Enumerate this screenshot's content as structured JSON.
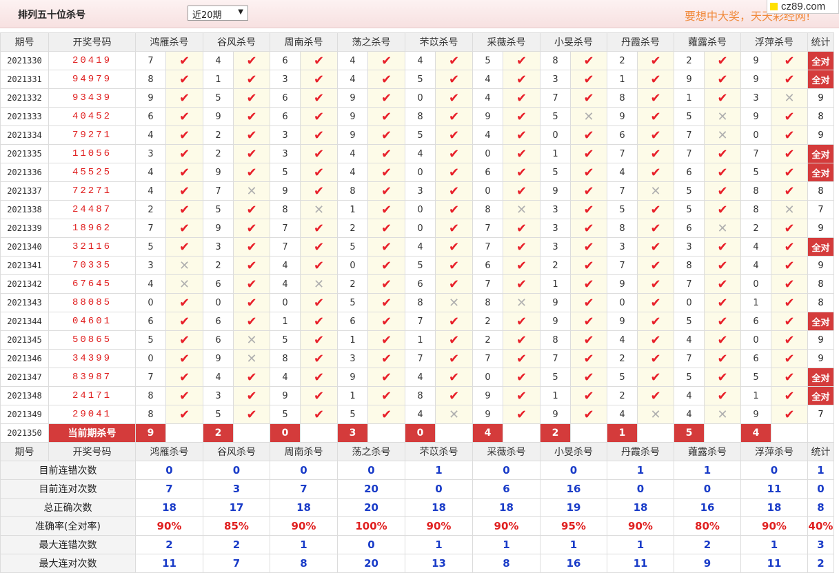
{
  "header": {
    "title": "排列五十位杀号",
    "range_selected": "近20期",
    "slogan": "要想中大奖，天天彩经网!",
    "logo_text": "cz89.com"
  },
  "table": {
    "headers": [
      "期号",
      "开奖号码",
      "鸿雁杀号",
      "谷风杀号",
      "周南杀号",
      "荡之杀号",
      "芣苡杀号",
      "采薇杀号",
      "小旻杀号",
      "丹霞杀号",
      "蕹露杀号",
      "浮萍杀号",
      "统计"
    ],
    "rows": [
      {
        "period": "2021330",
        "draw": "20419",
        "kills": [
          "7",
          "4",
          "6",
          "4",
          "4",
          "5",
          "8",
          "2",
          "2",
          "9"
        ],
        "hits": [
          1,
          1,
          1,
          1,
          1,
          1,
          1,
          1,
          1,
          1
        ],
        "total": "全对"
      },
      {
        "period": "2021331",
        "draw": "94979",
        "kills": [
          "8",
          "1",
          "3",
          "4",
          "5",
          "4",
          "3",
          "1",
          "9",
          "9"
        ],
        "hits": [
          1,
          1,
          1,
          1,
          1,
          1,
          1,
          1,
          1,
          1
        ],
        "total": "全对"
      },
      {
        "period": "2021332",
        "draw": "93439",
        "kills": [
          "9",
          "5",
          "6",
          "9",
          "0",
          "4",
          "7",
          "8",
          "1",
          "3"
        ],
        "hits": [
          1,
          1,
          1,
          1,
          1,
          1,
          1,
          1,
          1,
          0
        ],
        "total": "9"
      },
      {
        "period": "2021333",
        "draw": "40452",
        "kills": [
          "6",
          "9",
          "6",
          "9",
          "8",
          "9",
          "5",
          "9",
          "5",
          "9"
        ],
        "hits": [
          1,
          1,
          1,
          1,
          1,
          1,
          0,
          1,
          0,
          1
        ],
        "total": "8"
      },
      {
        "period": "2021334",
        "draw": "79271",
        "kills": [
          "4",
          "2",
          "3",
          "9",
          "5",
          "4",
          "0",
          "6",
          "7",
          "0"
        ],
        "hits": [
          1,
          1,
          1,
          1,
          1,
          1,
          1,
          1,
          0,
          1
        ],
        "total": "9"
      },
      {
        "period": "2021335",
        "draw": "11056",
        "kills": [
          "3",
          "2",
          "3",
          "4",
          "4",
          "0",
          "1",
          "7",
          "7",
          "7"
        ],
        "hits": [
          1,
          1,
          1,
          1,
          1,
          1,
          1,
          1,
          1,
          1
        ],
        "total": "全对"
      },
      {
        "period": "2021336",
        "draw": "45525",
        "kills": [
          "4",
          "9",
          "5",
          "4",
          "0",
          "6",
          "5",
          "4",
          "6",
          "5"
        ],
        "hits": [
          1,
          1,
          1,
          1,
          1,
          1,
          1,
          1,
          1,
          1
        ],
        "total": "全对"
      },
      {
        "period": "2021337",
        "draw": "72271",
        "kills": [
          "4",
          "7",
          "9",
          "8",
          "3",
          "0",
          "9",
          "7",
          "5",
          "8"
        ],
        "hits": [
          1,
          0,
          1,
          1,
          1,
          1,
          1,
          0,
          1,
          1
        ],
        "total": "8"
      },
      {
        "period": "2021338",
        "draw": "24487",
        "kills": [
          "2",
          "5",
          "8",
          "1",
          "0",
          "8",
          "3",
          "5",
          "5",
          "8"
        ],
        "hits": [
          1,
          1,
          0,
          1,
          1,
          0,
          1,
          1,
          1,
          0
        ],
        "total": "7"
      },
      {
        "period": "2021339",
        "draw": "18962",
        "kills": [
          "7",
          "9",
          "7",
          "2",
          "0",
          "7",
          "3",
          "8",
          "6",
          "2"
        ],
        "hits": [
          1,
          1,
          1,
          1,
          1,
          1,
          1,
          1,
          0,
          1
        ],
        "total": "9"
      },
      {
        "period": "2021340",
        "draw": "32116",
        "kills": [
          "5",
          "3",
          "7",
          "5",
          "4",
          "7",
          "3",
          "3",
          "3",
          "4"
        ],
        "hits": [
          1,
          1,
          1,
          1,
          1,
          1,
          1,
          1,
          1,
          1
        ],
        "total": "全对"
      },
      {
        "period": "2021341",
        "draw": "70335",
        "kills": [
          "3",
          "2",
          "4",
          "0",
          "5",
          "6",
          "2",
          "7",
          "8",
          "4"
        ],
        "hits": [
          0,
          1,
          1,
          1,
          1,
          1,
          1,
          1,
          1,
          1
        ],
        "total": "9"
      },
      {
        "period": "2021342",
        "draw": "67645",
        "kills": [
          "4",
          "6",
          "4",
          "2",
          "6",
          "7",
          "1",
          "9",
          "7",
          "0"
        ],
        "hits": [
          0,
          1,
          0,
          1,
          1,
          1,
          1,
          1,
          1,
          1
        ],
        "total": "8"
      },
      {
        "period": "2021343",
        "draw": "88085",
        "kills": [
          "0",
          "0",
          "0",
          "5",
          "8",
          "8",
          "9",
          "0",
          "0",
          "1"
        ],
        "hits": [
          1,
          1,
          1,
          1,
          0,
          0,
          1,
          1,
          1,
          1
        ],
        "total": "8"
      },
      {
        "period": "2021344",
        "draw": "04601",
        "kills": [
          "6",
          "6",
          "1",
          "6",
          "7",
          "2",
          "9",
          "9",
          "5",
          "6"
        ],
        "hits": [
          1,
          1,
          1,
          1,
          1,
          1,
          1,
          1,
          1,
          1
        ],
        "total": "全对"
      },
      {
        "period": "2021345",
        "draw": "50865",
        "kills": [
          "5",
          "6",
          "5",
          "1",
          "1",
          "2",
          "8",
          "4",
          "4",
          "0"
        ],
        "hits": [
          1,
          0,
          1,
          1,
          1,
          1,
          1,
          1,
          1,
          1
        ],
        "total": "9"
      },
      {
        "period": "2021346",
        "draw": "34399",
        "kills": [
          "0",
          "9",
          "8",
          "3",
          "7",
          "7",
          "7",
          "2",
          "7",
          "6"
        ],
        "hits": [
          1,
          0,
          1,
          1,
          1,
          1,
          1,
          1,
          1,
          1
        ],
        "total": "9"
      },
      {
        "period": "2021347",
        "draw": "83987",
        "kills": [
          "7",
          "4",
          "4",
          "9",
          "4",
          "0",
          "5",
          "5",
          "5",
          "5"
        ],
        "hits": [
          1,
          1,
          1,
          1,
          1,
          1,
          1,
          1,
          1,
          1
        ],
        "total": "全对"
      },
      {
        "period": "2021348",
        "draw": "24171",
        "kills": [
          "8",
          "3",
          "9",
          "1",
          "8",
          "9",
          "1",
          "2",
          "4",
          "1"
        ],
        "hits": [
          1,
          1,
          1,
          1,
          1,
          1,
          1,
          1,
          1,
          1
        ],
        "total": "全对"
      },
      {
        "period": "2021349",
        "draw": "29041",
        "kills": [
          "8",
          "5",
          "5",
          "5",
          "4",
          "9",
          "9",
          "4",
          "4",
          "9"
        ],
        "hits": [
          1,
          1,
          1,
          1,
          0,
          1,
          1,
          0,
          0,
          1
        ],
        "total": "7"
      }
    ],
    "current": {
      "period": "2021350",
      "label": "当前期杀号",
      "kills": [
        "9",
        "2",
        "0",
        "3",
        "0",
        "4",
        "2",
        "1",
        "5",
        "4"
      ]
    },
    "stats": [
      {
        "label": "目前连错次数",
        "values": [
          "0",
          "0",
          "0",
          "0",
          "1",
          "0",
          "0",
          "1",
          "1",
          "0",
          "1"
        ],
        "pct": false
      },
      {
        "label": "目前连对次数",
        "values": [
          "7",
          "3",
          "7",
          "20",
          "0",
          "6",
          "16",
          "0",
          "0",
          "11",
          "0"
        ],
        "pct": false
      },
      {
        "label": "总正确次数",
        "values": [
          "18",
          "17",
          "18",
          "20",
          "18",
          "18",
          "19",
          "18",
          "16",
          "18",
          "8"
        ],
        "pct": false
      },
      {
        "label": "准确率(全对率)",
        "values": [
          "90%",
          "85%",
          "90%",
          "100%",
          "90%",
          "90%",
          "95%",
          "90%",
          "80%",
          "90%",
          "40%"
        ],
        "pct": true
      },
      {
        "label": "最大连错次数",
        "values": [
          "2",
          "2",
          "1",
          "0",
          "1",
          "1",
          "1",
          "1",
          "2",
          "1",
          "3"
        ],
        "pct": false
      },
      {
        "label": "最大连对次数",
        "values": [
          "11",
          "7",
          "8",
          "20",
          "13",
          "8",
          "16",
          "11",
          "9",
          "11",
          "2"
        ],
        "pct": false
      }
    ]
  },
  "icons": {
    "hit": "check-mark-icon",
    "miss": "cross-mark-icon"
  },
  "colors": {
    "accent": "#d43b3b",
    "hit": "#e8202a",
    "miss": "#b0b0b0",
    "stat_value": "#1a3cc8",
    "draw_number": "#e02020"
  }
}
